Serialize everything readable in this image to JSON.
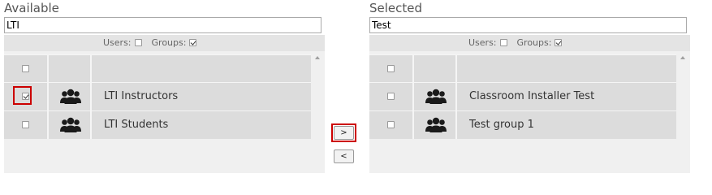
{
  "available": {
    "title": "Available",
    "filter_value": "LTI",
    "types": {
      "users_label": "Users:",
      "users_checked": false,
      "groups_label": "Groups:",
      "groups_checked": true
    },
    "rows": [
      {
        "name": "LTI Instructors",
        "checked": true,
        "icon": "group-icon"
      },
      {
        "name": "LTI Students",
        "checked": false,
        "icon": "group-icon"
      }
    ]
  },
  "selected": {
    "title": "Selected",
    "filter_value": "Test",
    "types": {
      "users_label": "Users:",
      "users_checked": false,
      "groups_label": "Groups:",
      "groups_checked": true
    },
    "rows": [
      {
        "name": "Classroom Installer Test",
        "checked": false,
        "icon": "group-icon"
      },
      {
        "name": "Test group 1",
        "checked": false,
        "icon": "group-icon"
      }
    ]
  },
  "controls": {
    "add_label": ">",
    "remove_label": "<"
  },
  "colors": {
    "highlight": "#cc0000",
    "row_bg": "#dcdcdc",
    "panel_bg": "#f0f0f0"
  }
}
